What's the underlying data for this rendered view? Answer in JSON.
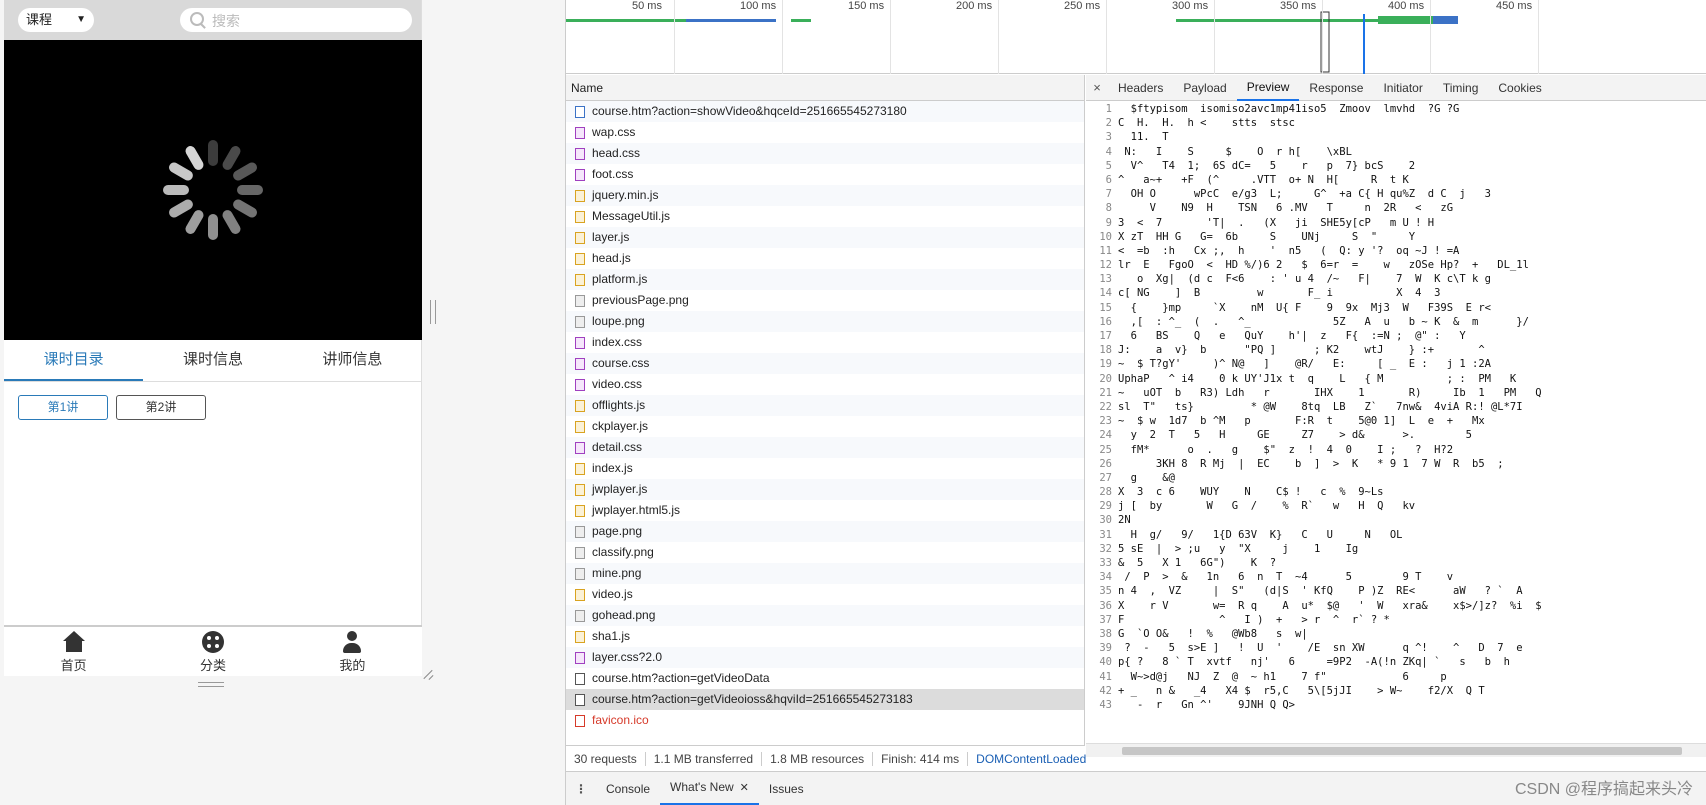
{
  "mobile": {
    "category_select": "课程",
    "search_placeholder": "搜索",
    "tabs": [
      "课时目录",
      "课时信息",
      "讲师信息"
    ],
    "lessons": [
      "第1讲",
      "第2讲"
    ],
    "nav": [
      {
        "label": "首页",
        "icon": "home-icon"
      },
      {
        "label": "分类",
        "icon": "category-icon"
      },
      {
        "label": "我的",
        "icon": "user-icon"
      }
    ]
  },
  "timeline": {
    "ticks": [
      "50 ms",
      "100 ms",
      "150 ms",
      "200 ms",
      "250 ms",
      "300 ms",
      "350 ms",
      "400 ms",
      "450 ms"
    ]
  },
  "network": {
    "name_header": "Name",
    "requests": [
      {
        "name": "course.htm?action=showVideo&hqceId=251665545273180",
        "type": "doc"
      },
      {
        "name": "wap.css",
        "type": "css"
      },
      {
        "name": "head.css",
        "type": "css"
      },
      {
        "name": "foot.css",
        "type": "css"
      },
      {
        "name": "jquery.min.js",
        "type": "js"
      },
      {
        "name": "MessageUtil.js",
        "type": "js"
      },
      {
        "name": "layer.js",
        "type": "js"
      },
      {
        "name": "head.js",
        "type": "js"
      },
      {
        "name": "platform.js",
        "type": "js"
      },
      {
        "name": "previousPage.png",
        "type": "img"
      },
      {
        "name": "loupe.png",
        "type": "img"
      },
      {
        "name": "index.css",
        "type": "css"
      },
      {
        "name": "course.css",
        "type": "css"
      },
      {
        "name": "video.css",
        "type": "css"
      },
      {
        "name": "offlights.js",
        "type": "js"
      },
      {
        "name": "ckplayer.js",
        "type": "js"
      },
      {
        "name": "detail.css",
        "type": "css"
      },
      {
        "name": "index.js",
        "type": "js"
      },
      {
        "name": "jwplayer.js",
        "type": "js"
      },
      {
        "name": "jwplayer.html5.js",
        "type": "js"
      },
      {
        "name": "page.png",
        "type": "img"
      },
      {
        "name": "classify.png",
        "type": "img"
      },
      {
        "name": "mine.png",
        "type": "img"
      },
      {
        "name": "video.js",
        "type": "js"
      },
      {
        "name": "gohead.png",
        "type": "img"
      },
      {
        "name": "sha1.js",
        "type": "js"
      },
      {
        "name": "layer.css?2.0",
        "type": "css"
      },
      {
        "name": "course.htm?action=getVideoData",
        "type": "xhr"
      },
      {
        "name": "course.htm?action=getVideoioss&hqviId=251665545273183",
        "type": "xhr",
        "selected": true
      },
      {
        "name": "favicon.ico",
        "type": "errf",
        "error": true
      }
    ],
    "status": {
      "requests": "30 requests",
      "transferred": "1.1 MB transferred",
      "resources": "1.8 MB resources",
      "finish": "Finish: 414 ms",
      "dom": "DOMContentLoaded"
    }
  },
  "detail": {
    "tabs": [
      "Headers",
      "Payload",
      "Preview",
      "Response",
      "Initiator",
      "Timing",
      "Cookies"
    ],
    "active_tab": "Preview",
    "preview_lines": [
      "  $ftypisom  isomiso2avc1mp41iso5  Zmoov  lmvhd  ?G ?G  ",
      "C  H.  H.  h <    stts  stsc",
      "  11.  T",
      " N:   I    S     $    O  r h[    \\xBL ",
      "  V^   T4  1;  6S dC=   5    r   p  7} bcS    2",
      "^   a~+   +F  (^     .VTT  o+ N  H[     R  t K",
      "  OH O      wPcC  e/g3  L;     G^  +a C{ H qu%Z  d C  j   3 ",
      "     V    N9  H    TSN   6 .MV   T     n  2R   <   zG",
      "3  <  7       'T|  .   (X   ji  SHE5y[cP   m U ! H",
      "X zT  HH G   G=  6b     S    UNj     S  \"     Y",
      "<  =b  :h   Cx ;,  h    '  n5   (  Q: y '?  oq ~J ! =A  ",
      "lr  E   FgoO  <  HD %/)6 2   $  6=r  =    w   zOSe Hp?  +   DL_1l",
      "   o  Xg|  (d c  F<6    : ' u 4  /~   F|    7  W  K c\\T k g",
      "c[ NG    ]  B         w       F_ i          X  4  3",
      "  {    }mp     `X    nM  U{ F    9  9x  Mj3  W   F39S  E r<",
      "  ,[  : ^_  (  .   ^_             5Z   A  u   b ~ K  &  m      }/",
      "  6   BS    Q   e   QuY    h'|  z   F{  :=N ;  @\" :   Y",
      "J:    a  v}  b      \"PQ ]      ; K2    wtJ    } :+       ^",
      "~  $ T?gY'     )^ N@   ]    @R/   E:     [ _  E :   j 1 :2A",
      "UphaP   ^ i4    0 k UY'J1x t  q    L   { M          ; :  PM   K",
      "~   uOT  b   R3) Ldh   r       IHX    1       R)     Ib  1   PM   Q",
      "sl  T\"   ts}         * @W    8tq  LB   Z`   7nw&  4viA R:! @L*7I",
      "~  $ w  1d7  b ^M   p       F:R  t    5@0 1]  L  e  +   Mx",
      "  y  2  T   5   H     GE     Z7    > d&      >.        5  ",
      "  fM*      o  .   g    $\"  z  !  4  0    I ;   ?  H?2    ",
      "      3KH 8  R Mj  |  EC    b  ]  >  K   * 9 1  7 W  R  b5  ;",
      "  g    &@",
      "X  3  c 6    WUY    N    C$ !   c  %  9~Ls",
      "j [  by       W   G  /    %  R`   w   H  Q   kv      ",
      "2N",
      "  H  g/   9/   1{D 63V  K}   C   U     N   OL     ",
      "5 sE  |  > ;u   y  \"X     j    1    Ig  ",
      "&  5   X 1   6G\")    K  ?   ",
      " /  P  >  &   1n   6  n  T  ~4      5        9 T    v",
      "n 4  ,  VZ     |  S\"   (d|S  ' KfQ    P )Z  RE<      aW   ? `  A",
      "X    r V       w=  R q    A  u*  $@   '  W   xra&    x$>/]z?  %i  $",
      "F               ^   I )  +   > r  ^  r` ? * ",
      "G  `O O&   !  %   @Wb8   s  w|",
      " ?  -   5  s>E ]   !  U  '    /E  sn XW      q ^!    ^   D  7  e",
      "p{ ?   8 ` T  xvtf   nj'   6     =9P2  -A(!n ZKq| `   s   b  h",
      "  W~>d@j   NJ  Z  @  ~ h1    7 f\"            6     p",
      "+ _   n &   _4   X4 $  r5,C   5\\[5jJI    > W~    f2/X  Q T  ",
      "   -  r   Gn ^'    9JNH Q Q> "
    ]
  },
  "drawer": {
    "tabs": [
      "Console",
      "What's New",
      "Issues"
    ],
    "active_tab": "What's New"
  },
  "watermark": "CSDN @程序搞起来头冷",
  "colors": {
    "accent": "#1a73e8",
    "mobile_accent": "#2a7ab8",
    "error": "#d63a2a"
  }
}
